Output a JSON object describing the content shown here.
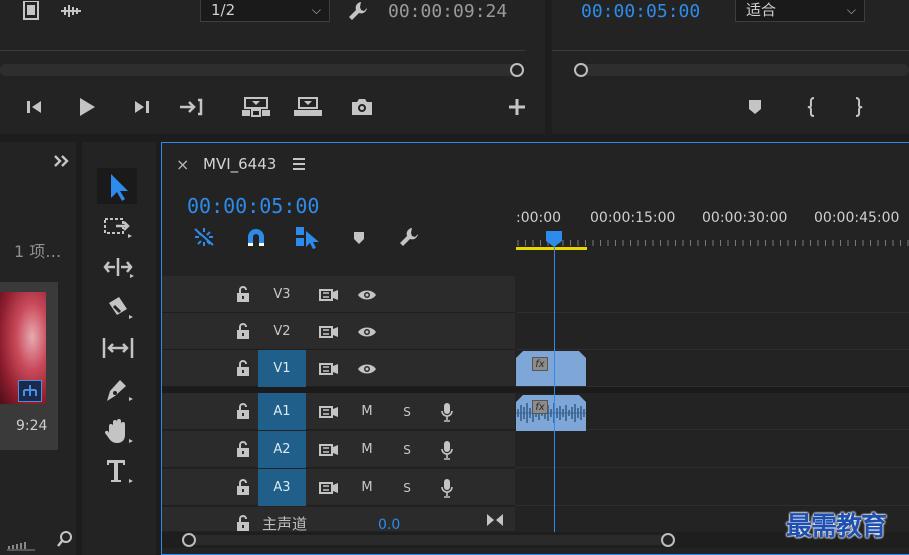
{
  "source_monitor": {
    "resolution_select": "1/2",
    "timecode": "00:00:09:24"
  },
  "program_monitor": {
    "timecode": "00:00:05:00",
    "zoom_select": "适合"
  },
  "project_panel": {
    "item_count": "1 项…",
    "thumb_duration": "9:24"
  },
  "timeline": {
    "sequence_name": "MVI_6443",
    "timecode": "00:00:05:00",
    "ruler": [
      ":00:00",
      "00:00:15:00",
      "00:00:30:00",
      "00:00:45:00"
    ],
    "video_tracks": [
      {
        "name": "V3"
      },
      {
        "name": "V2"
      },
      {
        "name": "V1"
      }
    ],
    "audio_tracks": [
      {
        "name": "A1",
        "mute": "M",
        "solo": "S"
      },
      {
        "name": "A2",
        "mute": "M",
        "solo": "S"
      },
      {
        "name": "A3",
        "mute": "M",
        "solo": "S"
      }
    ],
    "master": {
      "label": "主声道",
      "value": "0.0"
    },
    "fx_label": "fx"
  },
  "watermark": "最需教育",
  "colors": {
    "accent_blue": "#2d8ceb",
    "track_target": "#1f5f8a",
    "clip_blue": "#7ea6d6",
    "work_area_yellow": "#e8d800"
  }
}
